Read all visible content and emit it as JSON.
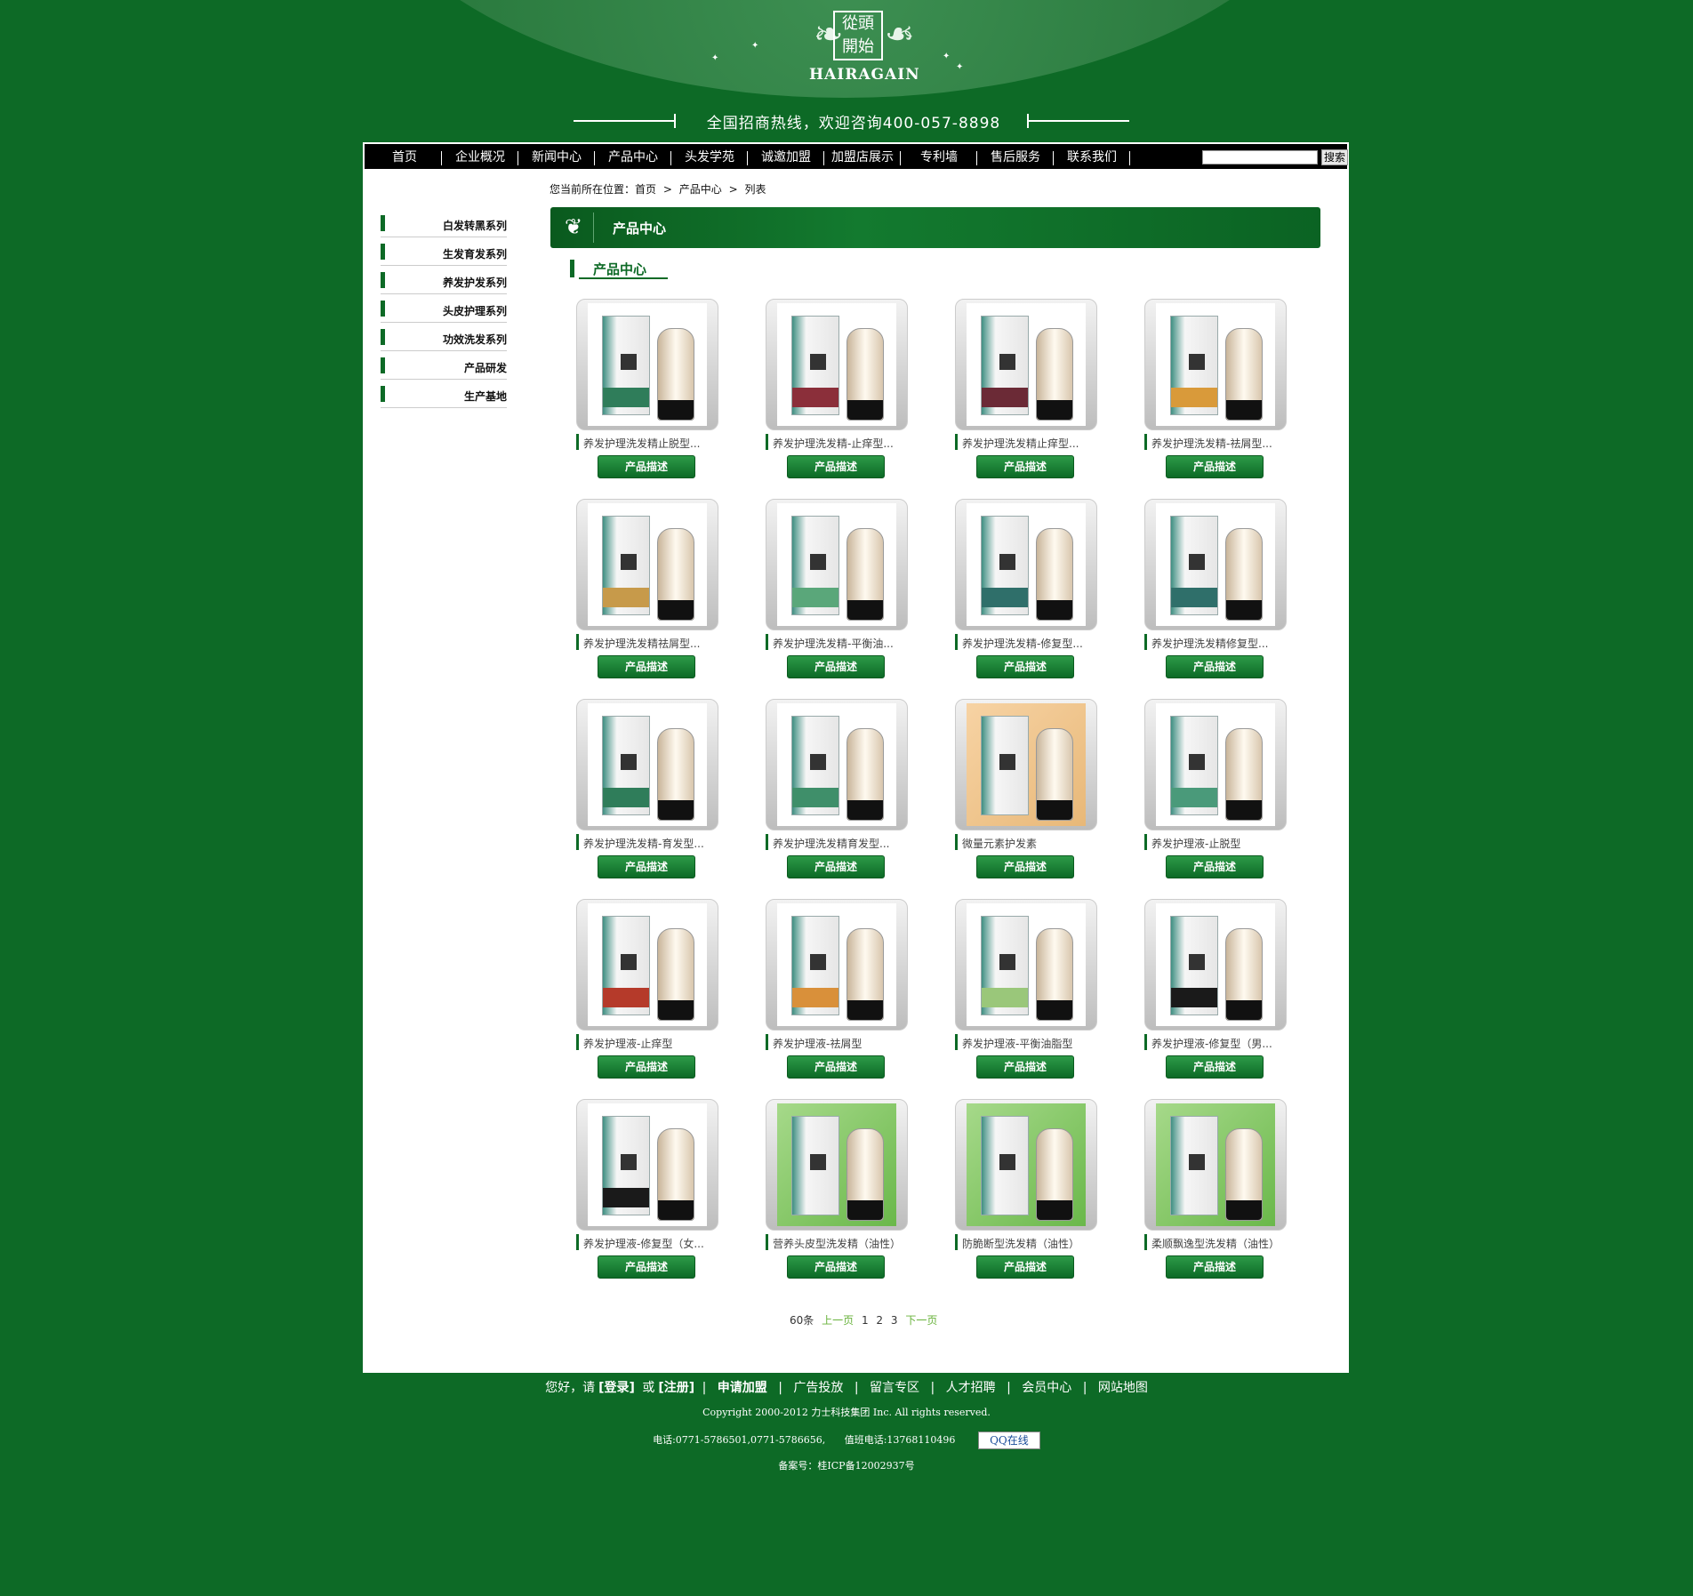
{
  "brand": {
    "logo_chars": [
      "從",
      "頭",
      "開",
      "始"
    ],
    "logo_word": "HAIRAGAIN",
    "hotline": "全国招商热线，欢迎咨询400-057-8898"
  },
  "nav": {
    "items": [
      "首页",
      "企业概况",
      "新闻中心",
      "产品中心",
      "头发学苑",
      "诚邀加盟",
      "加盟店展示",
      "专利墙",
      "售后服务",
      "联系我们"
    ],
    "search_button": "搜索"
  },
  "breadcrumb": [
    "您当前所在位置：首页",
    "产品中心",
    "列表"
  ],
  "sidebar": {
    "items": [
      "白发转黑系列",
      "生发育发系列",
      "养发护发系列",
      "头皮护理系列",
      "功效洗发系列",
      "产品研发",
      "生产基地"
    ]
  },
  "section": {
    "title": "产品中心",
    "subtitle": "产品中心"
  },
  "products": [
    {
      "name": "养发护理洗发精止脱型...",
      "button": "产品描述"
    },
    {
      "name": "养发护理洗发精-止痒型...",
      "button": "产品描述"
    },
    {
      "name": "养发护理洗发精止痒型...",
      "button": "产品描述"
    },
    {
      "name": "养发护理洗发精-祛屑型...",
      "button": "产品描述"
    },
    {
      "name": "养发护理洗发精祛屑型...",
      "button": "产品描述"
    },
    {
      "name": "养发护理洗发精-平衡油...",
      "button": "产品描述"
    },
    {
      "name": "养发护理洗发精-修复型...",
      "button": "产品描述"
    },
    {
      "name": "养发护理洗发精修复型...",
      "button": "产品描述"
    },
    {
      "name": "养发护理洗发精-育发型...",
      "button": "产品描述"
    },
    {
      "name": "养发护理洗发精育发型...",
      "button": "产品描述"
    },
    {
      "name": "微量元素护发素",
      "button": "产品描述"
    },
    {
      "name": "养发护理液-止脱型",
      "button": "产品描述"
    },
    {
      "name": "养发护理液-止痒型",
      "button": "产品描述"
    },
    {
      "name": "养发护理液-祛屑型",
      "button": "产品描述"
    },
    {
      "name": "养发护理液-平衡油脂型",
      "button": "产品描述"
    },
    {
      "name": "养发护理液-修复型（男...",
      "button": "产品描述"
    },
    {
      "name": "养发护理液-修复型（女...",
      "button": "产品描述"
    },
    {
      "name": "营养头皮型洗发精（油性）",
      "button": "产品描述"
    },
    {
      "name": "防脆断型洗发精（油性）",
      "button": "产品描述"
    },
    {
      "name": "柔顺飘逸型洗发精（油性）",
      "button": "产品描述"
    }
  ],
  "pagination": {
    "total": "60条",
    "prev": "上一页",
    "pages": [
      "1",
      "2",
      "3"
    ],
    "next": "下一页"
  },
  "footer": {
    "greeting": "您好，请",
    "login": "[登录]",
    "or": "或",
    "register": "[注册]",
    "links": [
      "申请加盟",
      "广告投放",
      "留言专区",
      "人才招聘",
      "会员中心",
      "网站地图"
    ],
    "copyright": "Copyright  2000-2012  力士科技集团  Inc. All rights reserved.",
    "phone": "电话:0771-5786501,0771-5786656,",
    "duty_phone": "值班电话:13768110496",
    "qq": "QQ在线",
    "icp": "备案号：桂ICP备12002937号"
  },
  "colors": {
    "background": "#0d6a26",
    "accent": "#0d6a26",
    "link": "#67b23a"
  }
}
